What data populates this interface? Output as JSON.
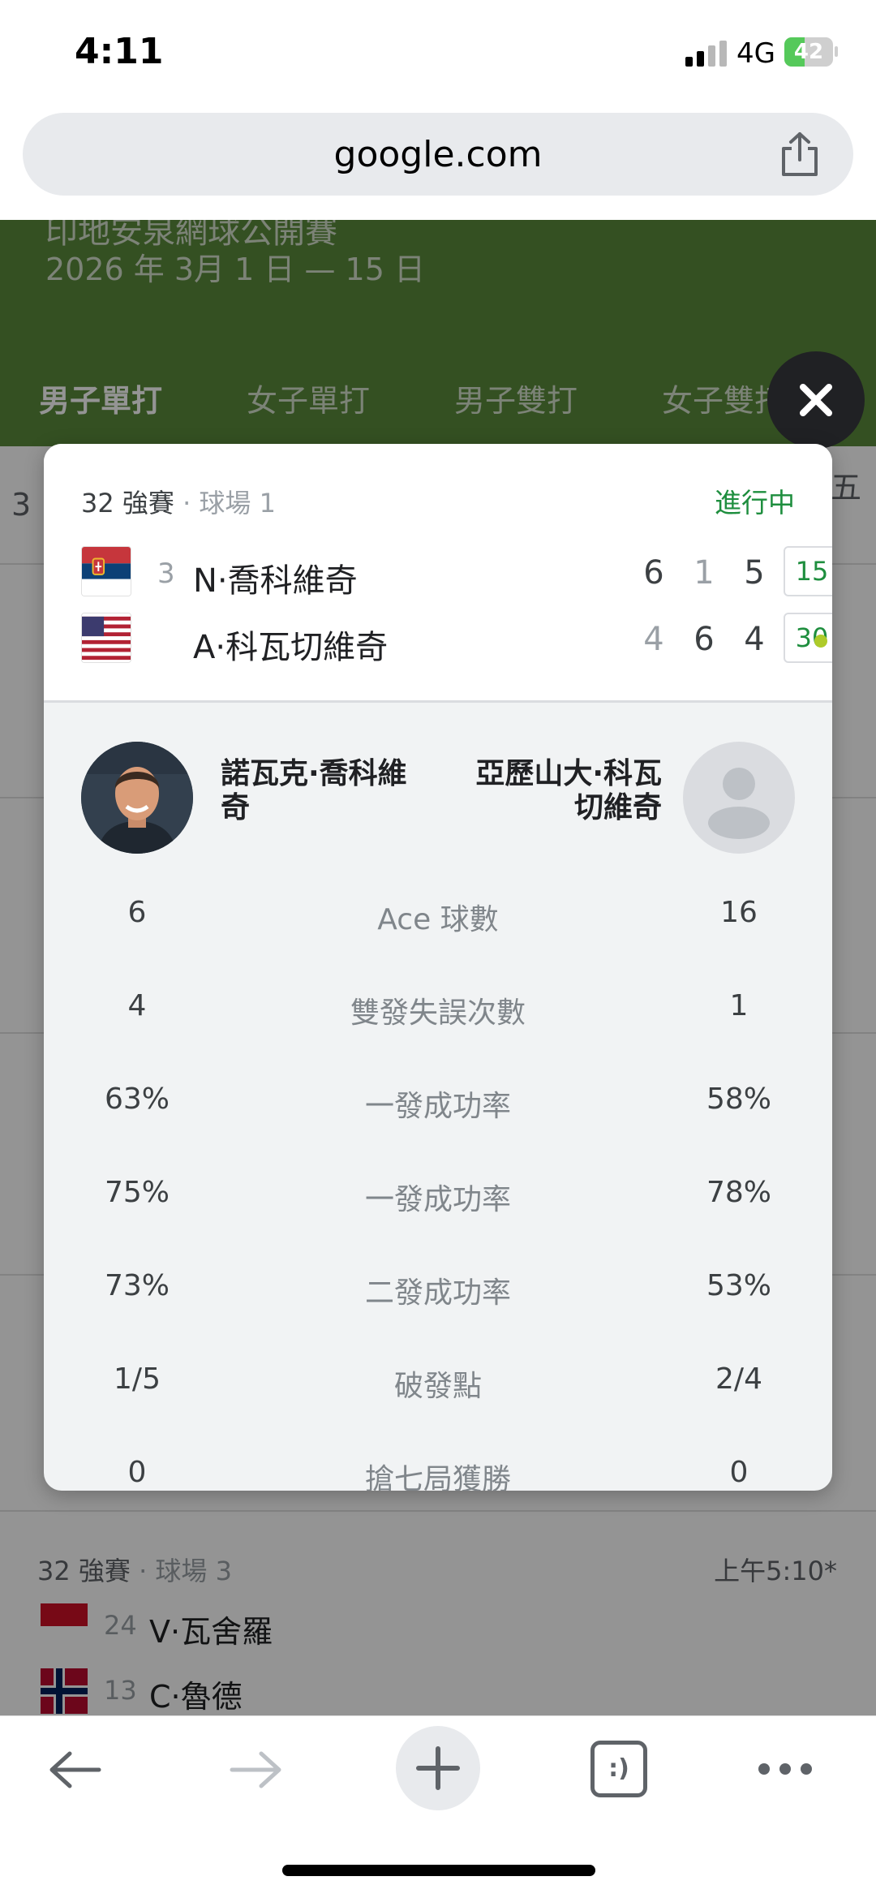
{
  "status_bar": {
    "time": "4:11",
    "network": "4G",
    "battery": "42",
    "battery_level": 0.42
  },
  "browser": {
    "url": "google.com"
  },
  "background_page": {
    "tournament_title": "印地安泉網球公開賽",
    "dates": "2026 年 3月 1 日 — 15 日",
    "tabs": [
      "男子單打",
      "女子單打",
      "男子雙打",
      "女子雙打"
    ],
    "edge_left": "3",
    "edge_right": "五",
    "match": {
      "round": "32 強賽",
      "court": "球場 3",
      "time": "上午5:10*",
      "players": [
        {
          "seed": "24",
          "name": "V·瓦舍羅"
        },
        {
          "seed": "13",
          "name": "C·魯德"
        }
      ]
    }
  },
  "popup": {
    "round": "32 強賽",
    "court": "球場 1",
    "status": "進行中",
    "players": [
      {
        "seed": "3",
        "name": "N·喬科維奇",
        "flag": "serbia-flag",
        "sets": [
          "6",
          "1",
          "5"
        ],
        "game": "15"
      },
      {
        "seed": "",
        "name": "A·科瓦切維奇",
        "flag": "usa-flag",
        "sets": [
          "4",
          "6",
          "4"
        ],
        "game": "30"
      }
    ],
    "left_full_name": "諾瓦克·喬科維奇",
    "right_full_name": "亞歷山大·科瓦切維奇",
    "stats": [
      {
        "label": "Ace 球數",
        "left": "6",
        "right": "16"
      },
      {
        "label": "雙發失誤次數",
        "left": "4",
        "right": "1"
      },
      {
        "label": "一發成功率",
        "left": "63%",
        "right": "58%"
      },
      {
        "label": "一發成功率",
        "left": "75%",
        "right": "78%"
      },
      {
        "label": "二發成功率",
        "left": "73%",
        "right": "53%"
      },
      {
        "label": "破發點",
        "left": "1/5",
        "right": "2/4"
      },
      {
        "label": "搶七局獲勝",
        "left": "0",
        "right": "0"
      }
    ]
  },
  "toolbar": {
    "tabs_label": ":)"
  },
  "colors": {
    "accent_green": "#1e8e3e",
    "header_green": "#5b8a3c",
    "serve_dot": "#aecb2a"
  }
}
